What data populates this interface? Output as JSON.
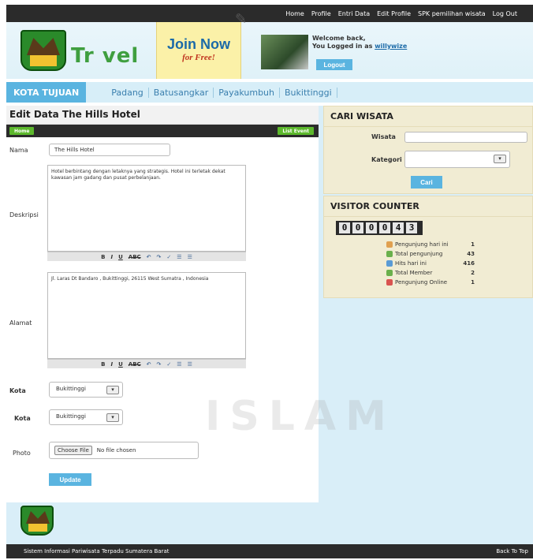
{
  "topnav": {
    "items": [
      "Home",
      "Profile",
      "Entri Data",
      "Edit Profile",
      "SPK pemilihan wisata",
      "Log Out"
    ]
  },
  "header": {
    "logo_text": "Tr vel",
    "join_now": "Join Now",
    "for_free": "for Free!",
    "welcome_line1": "Welcome back,",
    "welcome_line2": "You Logged in as",
    "username": "willywize",
    "logout_label": "Logout"
  },
  "nav": {
    "section_label": "KOTA TUJUAN",
    "cities": [
      "Padang",
      "Batusangkar",
      "Payakumbuh",
      "Bukittinggi"
    ]
  },
  "form": {
    "title": "Edit Data The Hills Hotel",
    "home_button": "Home",
    "list_button": "List Event",
    "nama_label": "Nama",
    "nama_value": "The Hills Hotel",
    "deskripsi_label": "Deskripsi",
    "deskripsi_value": "Hotel berbintang dengan letaknya yang strategis. Hotel ini terletak dekat kawasan jam gadang dan pusat perbelanjaan.",
    "alamat_label": "Alamat",
    "alamat_value": "Jl. Laras Dt Bandaro , Bukittinggi, 26115 West Sumatra , Indonesia",
    "editor_toolbar": [
      "B",
      "I",
      "U",
      "ABC",
      "↶",
      "↷",
      "✓",
      "☰",
      "☰"
    ],
    "kota_label_1": "Kota",
    "kota_value_1": "Bukittinggi",
    "kota_label_2": "Kota",
    "kota_value_2": "Bukittinggi",
    "photo_label": "Photo",
    "choose_file": "Choose File",
    "no_file": "No file chosen",
    "update_label": "Update"
  },
  "search_panel": {
    "title": "CARI WISATA",
    "wisata_label": "Wisata",
    "kategori_label": "Kategori",
    "cari_label": "Cari"
  },
  "visitor_panel": {
    "title": "VISITOR COUNTER",
    "digits": [
      "0",
      "0",
      "0",
      "0",
      "4",
      "3"
    ],
    "stats": [
      {
        "label": "Pengunjung hari ini",
        "value": "1"
      },
      {
        "label": "Total pengunjung",
        "value": "43"
      },
      {
        "label": "Hits hari ini",
        "value": "416"
      },
      {
        "label": "Total Member",
        "value": "2"
      },
      {
        "label": "Pengunjung Online",
        "value": "1"
      }
    ]
  },
  "footer": {
    "left": "Sistem Informasi Pariwisata Terpadu Sumatera Barat",
    "right": "Back To Top"
  },
  "watermark": "ISLAM",
  "colors": {
    "accent_blue": "#5ab4e0",
    "dark_bar": "#2b2b2b",
    "green_button": "#5cb82c",
    "panel_beige": "#f1ecd3"
  }
}
